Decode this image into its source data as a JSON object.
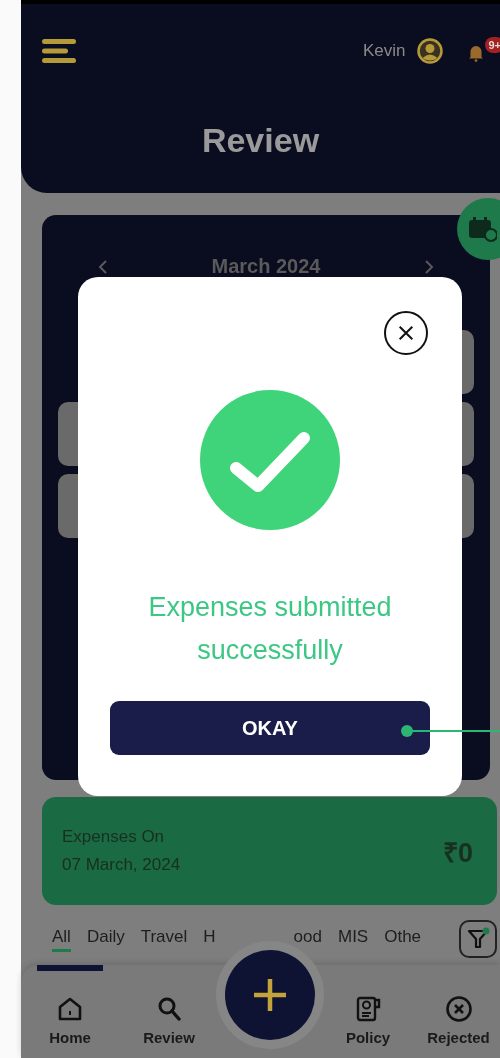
{
  "header": {
    "user_name": "Kevin",
    "notification_badge": "9+",
    "title": "Review"
  },
  "calendar": {
    "month": "March 2024"
  },
  "dialog": {
    "message": "Expenses submitted successfully",
    "button": "OKAY"
  },
  "summary_card": {
    "label": "Expenses On",
    "date": "07 March, 2024",
    "amount": "₹0"
  },
  "category_tabs": [
    {
      "label": "All",
      "selected": true
    },
    {
      "label": "Daily",
      "selected": false
    },
    {
      "label": "Travel",
      "selected": false
    },
    {
      "label": "H",
      "selected": false
    },
    {
      "label": "ood",
      "selected": false
    },
    {
      "label": "MIS",
      "selected": false
    },
    {
      "label": "Othe",
      "selected": false
    }
  ],
  "bottom_nav": [
    {
      "label": "Home",
      "selected": true
    },
    {
      "label": "Review",
      "selected": false
    },
    {
      "label": "Policy",
      "selected": false
    },
    {
      "label": "Rejected",
      "selected": false
    }
  ]
}
